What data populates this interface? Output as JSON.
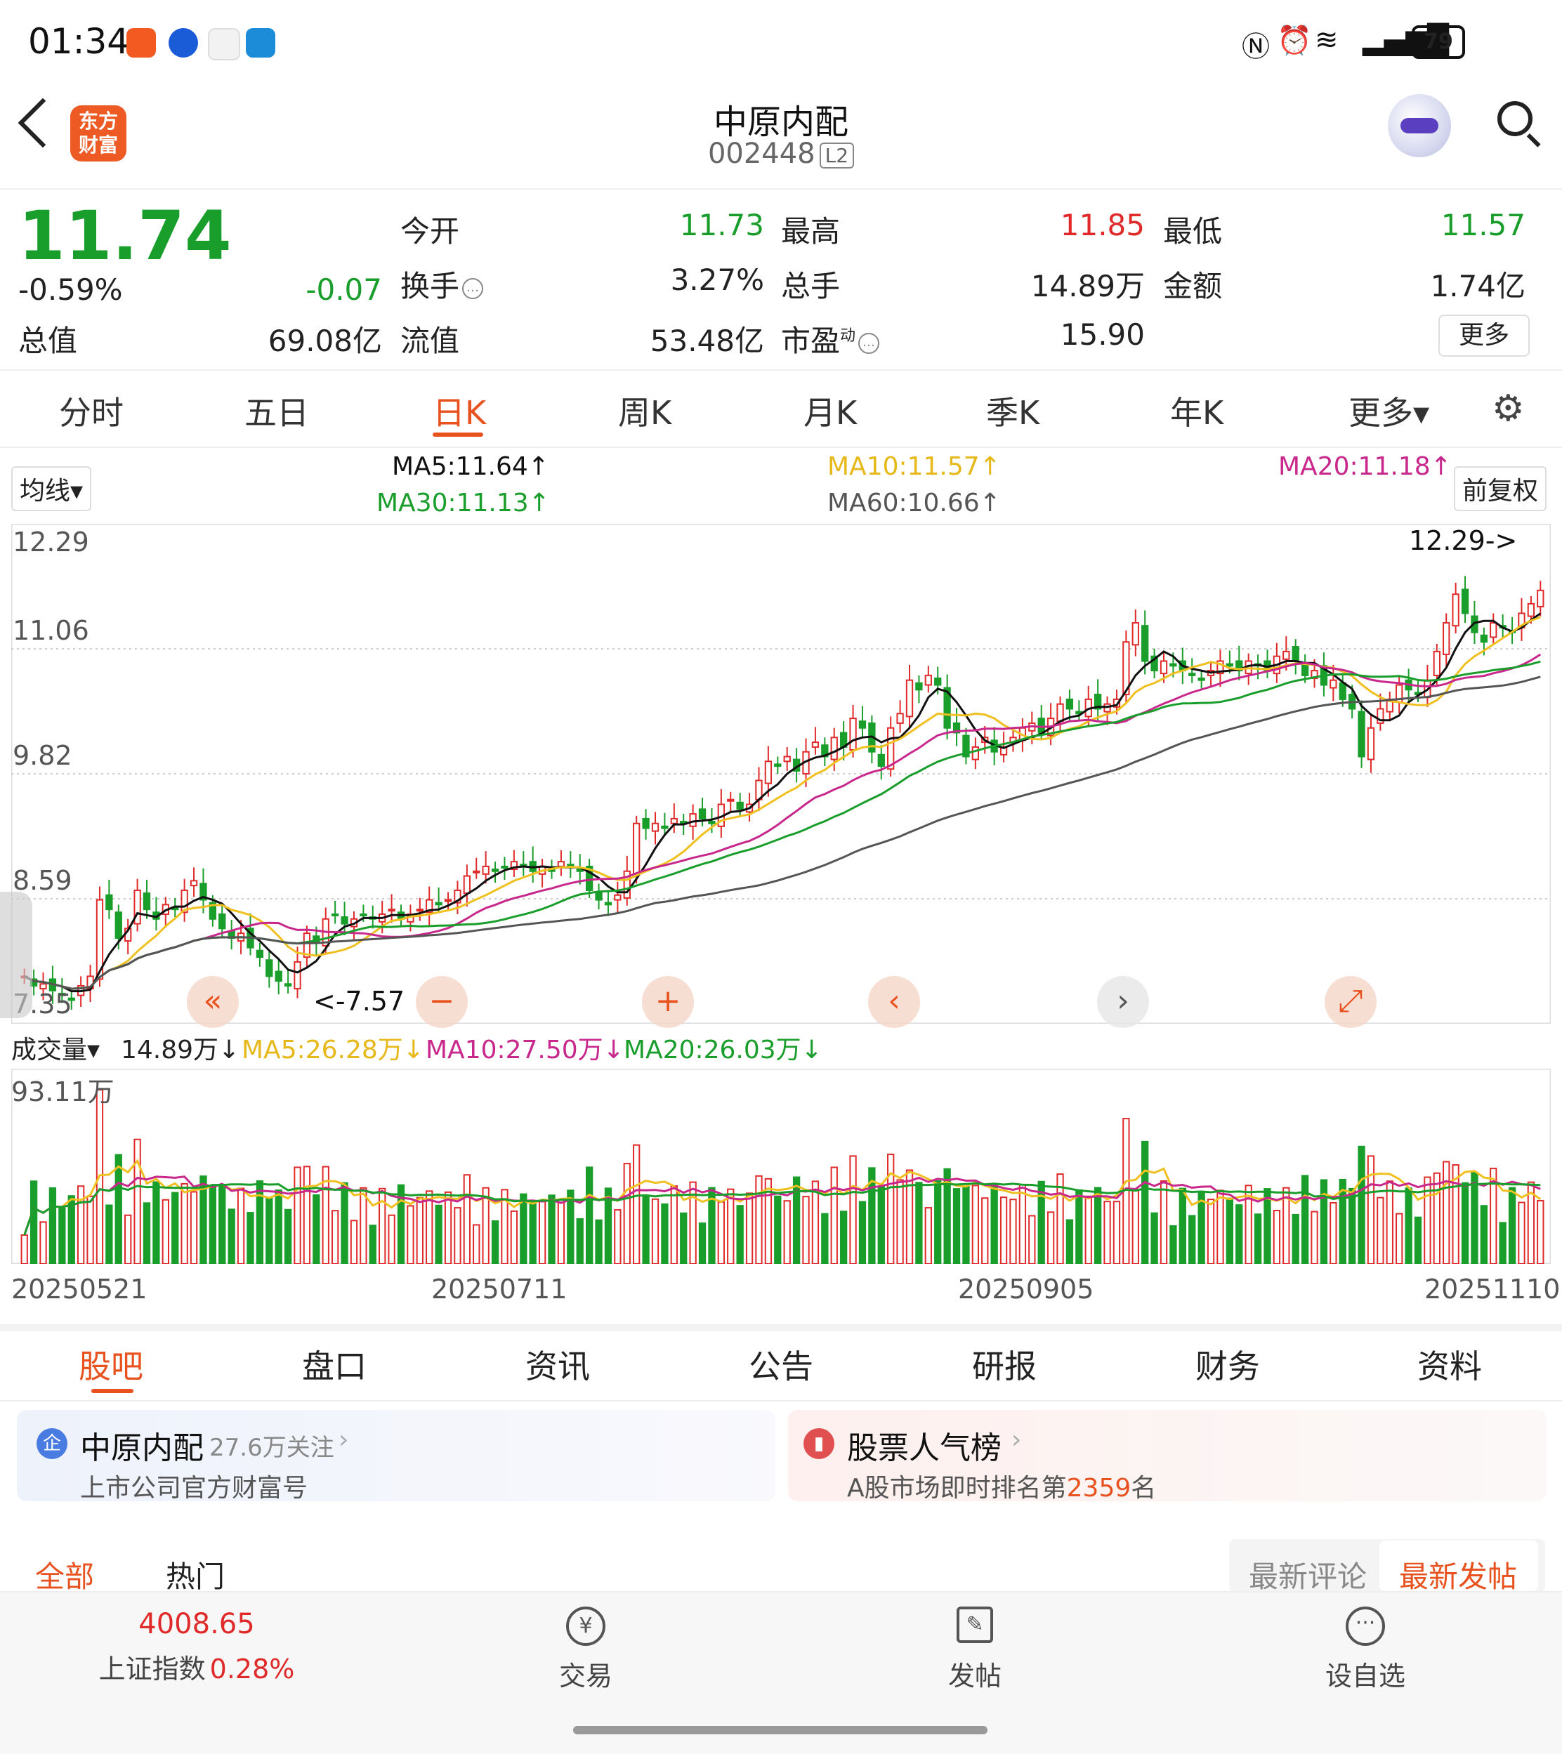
{
  "status_bar": {
    "time": "01:34",
    "battery": "79"
  },
  "header": {
    "title": "中原内配",
    "code": "002448",
    "level": "L2",
    "logo_text_1": "东方",
    "logo_text_2": "财富"
  },
  "quote": {
    "price": "11.74",
    "change_pct": "-0.59%",
    "change": "-0.07",
    "fields": {
      "open_label": "今开",
      "open": "11.73",
      "high_label": "最高",
      "high": "11.85",
      "low_label": "最低",
      "low": "11.57",
      "turnover_label": "换手",
      "turnover": "3.27%",
      "volume_label": "总手",
      "volume": "14.89万",
      "amount_label": "金额",
      "amount": "1.74亿",
      "mktcap_label": "总值",
      "mktcap": "69.08亿",
      "float_label": "流值",
      "float": "53.48亿",
      "pe_label": "市盈",
      "pe_sup": "动",
      "pe": "15.90"
    },
    "more": "更多"
  },
  "period_tabs": [
    "分时",
    "五日",
    "日K",
    "周K",
    "月K",
    "季K",
    "年K",
    "更多▾"
  ],
  "active_period": "日K",
  "ma_legend": {
    "selector": "均线▾",
    "ma5": "MA5:11.64↑",
    "ma10": "MA10:11.57↑",
    "ma20": "MA20:11.18↑",
    "ma30": "MA30:11.13↑",
    "ma60": "MA60:10.66↑",
    "adjust": "前复权"
  },
  "colors": {
    "up": "#e02a2a",
    "down": "#1a9e2b",
    "ma5": "#111111",
    "ma10": "#f0c020",
    "ma20": "#c8288c",
    "ma30": "#1a9e2b",
    "ma60": "#555555",
    "accent": "#e8521f"
  },
  "chart_data": {
    "type": "candlestick",
    "y_ticks": [
      "12.29",
      "11.06",
      "9.82",
      "8.59",
      "7.35"
    ],
    "ylim": [
      7.35,
      12.29
    ],
    "x_ticks": [
      "20250521",
      "20250711",
      "20250905",
      "20251110"
    ],
    "max_label": "12.29->",
    "min_label": "<-7.57",
    "close": [
      7.7,
      7.6,
      7.62,
      7.55,
      7.5,
      7.45,
      7.6,
      7.7,
      8.5,
      8.4,
      8.1,
      8.2,
      8.6,
      8.4,
      8.3,
      8.45,
      8.4,
      8.6,
      8.7,
      8.5,
      8.3,
      8.2,
      8.1,
      8.15,
      8.0,
      7.9,
      7.7,
      7.65,
      7.6,
      7.85,
      8.15,
      8.05,
      8.3,
      8.35,
      8.25,
      8.3,
      8.35,
      8.3,
      8.35,
      8.4,
      8.3,
      8.35,
      8.4,
      8.5,
      8.45,
      8.5,
      8.6,
      8.75,
      8.8,
      8.85,
      8.8,
      8.85,
      8.9,
      8.85,
      8.8,
      8.85,
      8.8,
      8.9,
      8.85,
      8.8,
      8.6,
      8.5,
      8.45,
      8.55,
      8.8,
      9.3,
      9.25,
      9.3,
      9.25,
      9.35,
      9.3,
      9.4,
      9.35,
      9.3,
      9.5,
      9.55,
      9.45,
      9.5,
      9.75,
      9.95,
      9.9,
      10.0,
      9.85,
      10.05,
      10.15,
      10.0,
      10.2,
      10.1,
      10.4,
      10.3,
      10.05,
      9.9,
      10.3,
      10.45,
      10.8,
      10.7,
      10.85,
      10.75,
      10.3,
      10.25,
      10.0,
      10.1,
      10.2,
      10.05,
      10.1,
      10.2,
      10.3,
      10.35,
      10.25,
      10.4,
      10.55,
      10.5,
      10.45,
      10.6,
      10.5,
      10.55,
      10.6,
      11.2,
      11.4,
      11.0,
      10.9,
      11.0,
      10.95,
      10.9,
      10.85,
      10.8,
      10.9,
      11.0,
      10.95,
      10.9,
      11.0,
      10.95,
      10.9,
      11.05,
      11.1,
      11.0,
      10.85,
      10.9,
      10.75,
      10.8,
      10.6,
      10.5,
      10.0,
      10.3,
      10.5,
      10.6,
      10.75,
      10.7,
      10.65,
      10.8,
      11.1,
      11.4,
      11.7,
      11.5,
      11.3,
      11.2,
      11.4,
      11.35,
      11.3,
      11.5,
      11.6,
      11.74
    ],
    "volume_max": "93.11万",
    "volume_label": "成交量▾",
    "volume_value": "14.89万↓",
    "vol_ma5": "MA5:26.28万↓",
    "vol_ma10": "MA10:27.50万↓",
    "vol_ma20": "MA20:26.03万↓"
  },
  "controls": {
    "zoom_out": "−",
    "zoom_in": "+"
  },
  "bottom_tabs": [
    "股吧",
    "盘口",
    "资讯",
    "公告",
    "研报",
    "财务",
    "资料"
  ],
  "active_bottom_tab": "股吧",
  "cards": {
    "left": {
      "icon": "企",
      "title": "中原内配",
      "follow": "27.6万关注",
      "subtitle": "上市公司官方财富号"
    },
    "right": {
      "title": "股票人气榜",
      "subtitle_prefix": "A股市场即时排名第",
      "rank": "2359",
      "subtitle_suffix": "名"
    }
  },
  "sub_tabs": {
    "all": "全部",
    "hot": "热门",
    "latest_comment": "最新评论",
    "latest_post": "最新发帖"
  },
  "nav": {
    "index_value": "4008.65",
    "index_name": "上证指数",
    "index_change": "0.28%",
    "trade": "交易",
    "trade_icon": "¥",
    "post": "发帖",
    "watch": "设自选"
  }
}
